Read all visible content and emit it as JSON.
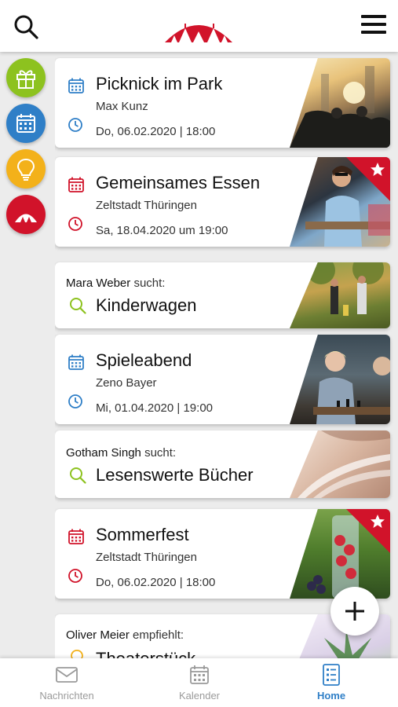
{
  "colors": {
    "accent_blue": "#2f7fc7",
    "accent_red": "#d1132a",
    "accent_green": "#8dc21f",
    "accent_yellow": "#f3b11a",
    "star_badge": "#d1132a"
  },
  "header": {
    "search_icon": "search-icon",
    "logo_icon": "tent-logo-icon",
    "menu_icon": "hamburger-menu-icon"
  },
  "rail": [
    {
      "icon": "gift-icon",
      "color": "#8dc21f"
    },
    {
      "icon": "calendar-icon",
      "color": "#2f7fc7"
    },
    {
      "icon": "lightbulb-icon",
      "color": "#f3b11a"
    },
    {
      "icon": "tent-icon",
      "color": "#d1132a"
    }
  ],
  "feed": {
    "cards": [
      {
        "type": "event",
        "title": "Picknick im Park",
        "organizer": "Max Kunz",
        "date": "Do, 06.02.2020 | 18:00",
        "color": "blue",
        "featured": false
      },
      {
        "type": "event",
        "title": "Gemeinsames Essen",
        "organizer": "Zeltstadt Thüringen",
        "date": "Sa, 18.04.2020 um 19:00",
        "color": "red",
        "featured": true
      },
      {
        "type": "search",
        "person": "Mara Weber",
        "verb": "sucht:",
        "title": "Kinderwagen"
      },
      {
        "type": "event",
        "title": "Spieleabend",
        "organizer": "Zeno Bayer",
        "date": "Mi, 01.04.2020 | 19:00",
        "color": "blue",
        "featured": false
      },
      {
        "type": "search",
        "person": "Gotham Singh",
        "verb": "sucht:",
        "title": "Lesenswerte Bücher"
      },
      {
        "type": "event",
        "title": "Sommerfest",
        "organizer": "Zeltstadt Thüringen",
        "date": "Do, 06.02.2020 | 18:00",
        "color": "red",
        "featured": true
      },
      {
        "type": "recommend",
        "person": "Oliver Meier",
        "verb": "empfiehlt:",
        "title": "Theaterstück"
      }
    ]
  },
  "fab": {
    "icon": "plus-icon"
  },
  "bottom_nav": {
    "items": [
      {
        "label": "Nachrichten",
        "icon": "envelope-icon",
        "active": false
      },
      {
        "label": "Kalender",
        "icon": "calendar-icon",
        "active": false
      },
      {
        "label": "Home",
        "icon": "home-list-icon",
        "active": true
      }
    ]
  }
}
